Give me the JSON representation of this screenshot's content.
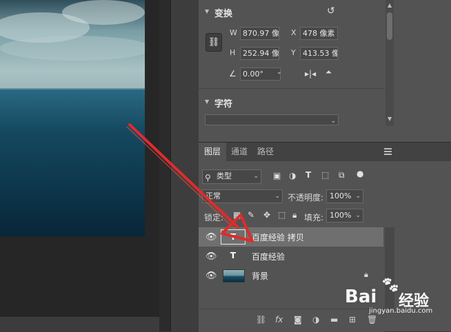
{
  "properties": {
    "transform_title": "变换",
    "w_label": "W",
    "w_value": "870.97 像",
    "x_label": "X",
    "x_value": "478 像素",
    "h_label": "H",
    "h_value": "252.94 像",
    "y_label": "Y",
    "y_value": "413.53 像",
    "angle_value": "0.00°",
    "character_title": "字符"
  },
  "layers_panel": {
    "tabs": [
      "图层",
      "通道",
      "路径"
    ],
    "filter_kind": "类型",
    "blend_mode": "正常",
    "opacity_label": "不透明度:",
    "opacity_value": "100%",
    "lock_label": "锁定:",
    "fill_label": "填充:",
    "fill_value": "100%",
    "layers": [
      {
        "name": "百度经验 拷贝",
        "type": "text",
        "selected": true
      },
      {
        "name": "百度经验",
        "type": "text",
        "selected": false
      },
      {
        "name": "背景",
        "type": "image",
        "selected": false,
        "locked": true
      }
    ],
    "bottom_icons": [
      "link-icon",
      "fx-icon",
      "mask-icon",
      "adjustment-icon",
      "group-folder-icon",
      "new-layer-icon",
      "trash-icon"
    ]
  },
  "watermark": {
    "brand": "Bai",
    "brand2": "经验",
    "url": "jingyan.baidu.com"
  },
  "annotation_color": "#e02b2b"
}
